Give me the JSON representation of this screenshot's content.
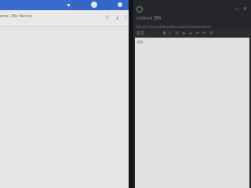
{
  "left_window": {
    "address_text": "ame. (No Name)",
    "toolbar_icons": [
      "star-icon",
      "download-icon",
      "more-icon"
    ],
    "colors": {
      "titlebar": "#3465c8",
      "content": "#e7e4e4"
    }
  },
  "right_window": {
    "tab_label": "Untitled 文档",
    "tab_close": "×",
    "path_text": "file:///C:/Users/Admin/Documents/Untitled.html",
    "format_dropdown": "正文",
    "toolbar_icons": [
      "bold-icon",
      "italic-icon",
      "underline-icon",
      "list-icon",
      "indent-icon",
      "undo-icon",
      "redo-icon",
      "link-icon"
    ],
    "editor_first_line": "文档",
    "colors": {
      "background": "#26272b",
      "editor": "#e2dfdf"
    }
  }
}
